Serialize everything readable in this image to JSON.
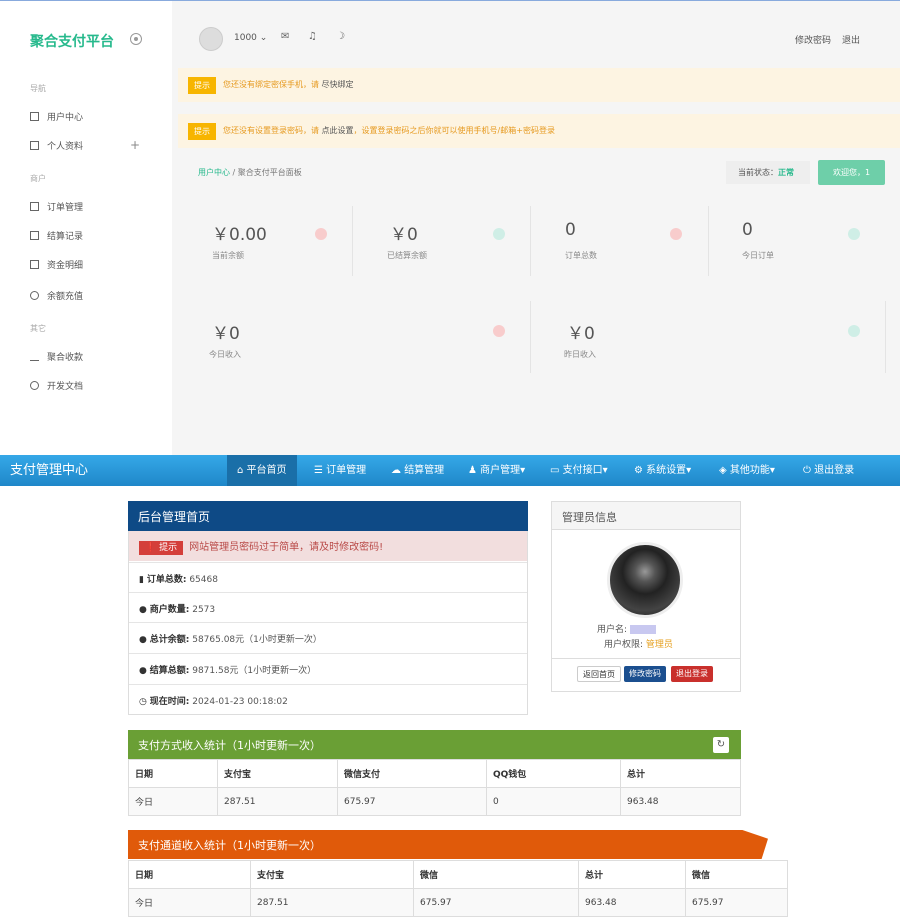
{
  "top_ui": {
    "brand": "聚合支付平台",
    "sidebar": {
      "sections": [
        "导航",
        "商户",
        "其它"
      ],
      "items": [
        {
          "label": "用户中心",
          "icon": "grid-icon"
        },
        {
          "label": "个人资料",
          "icon": "bookmark-icon"
        },
        {
          "label": "订单管理",
          "icon": "monitor-icon"
        },
        {
          "label": "结算记录",
          "icon": "dots-grid-icon"
        },
        {
          "label": "资金明细",
          "icon": "calendar-icon"
        },
        {
          "label": "余额充值",
          "icon": "plus-circle-icon"
        },
        {
          "label": "聚合收款",
          "icon": "bar-chart-icon"
        },
        {
          "label": "开发文档",
          "icon": "cloud-icon"
        }
      ]
    },
    "topbar": {
      "user_id": "1000",
      "change_password": "修改密码",
      "logout": "退出"
    },
    "alerts": [
      {
        "tag": "提示",
        "text": "您还没有绑定密保手机，请",
        "link": "尽快绑定",
        "extra": ""
      },
      {
        "tag": "提示",
        "text": "您还没有设置登录密码，请",
        "link": "点此设置",
        "extra": "，设置登录密码之后你就可以使用手机号/邮箱+密码登录"
      }
    ],
    "breadcrumb": [
      "用户中心",
      "聚合支付平台面板"
    ],
    "status_label": "当前状态：",
    "status_value": "正常",
    "welcome": "欢迎您，1",
    "stats": [
      {
        "value": "￥0.00",
        "label": "当前余额",
        "color": "#f8cccc"
      },
      {
        "value": "￥0",
        "label": "已结算余额",
        "color": "#cfeee6"
      },
      {
        "value": "0",
        "label": "订单总数",
        "color": "#f8cccc"
      },
      {
        "value": "0",
        "label": "今日订单",
        "color": "#cfeee6"
      },
      {
        "value": "￥0",
        "label": "今日收入",
        "color": "#f8cccc"
      },
      {
        "value": "￥0",
        "label": "昨日收入",
        "color": "#cfeee6"
      }
    ]
  },
  "admin_ui": {
    "brand": "支付管理中心",
    "nav": [
      "平台首页",
      "订单管理",
      "结算管理",
      "商户管理▾",
      "支付接口▾",
      "系统设置▾",
      "其他功能▾",
      "退出登录"
    ],
    "home_panel": {
      "title": "后台管理首页",
      "alert_tag": "提示",
      "alert_text": "网站管理员密码过于简单，请及时修改密码!",
      "rows": [
        {
          "label": "订单总数:",
          "value": "65468"
        },
        {
          "label": "商户数量:",
          "value": "2573"
        },
        {
          "label": "总计余额:",
          "value": "58765.08元（1小时更新一次）"
        },
        {
          "label": "结算总额:",
          "value": "9871.58元（1小时更新一次）"
        },
        {
          "label": "现在时间:",
          "value": "2024-01-23 00:18:02"
        }
      ]
    },
    "admin_panel": {
      "title": "管理员信息",
      "username_label": "用户名:",
      "perm_label": "用户权限:",
      "perm_value": "管理员",
      "buttons": [
        "返回首页",
        "修改密码",
        "退出登录"
      ]
    },
    "pay_method_table": {
      "title": "支付方式收入统计（1小时更新一次）",
      "header": [
        "日期",
        "支付宝",
        "微信支付",
        "QQ钱包",
        "总计"
      ],
      "rows": [
        [
          "今日",
          "287.51",
          "675.97",
          "0",
          "963.48"
        ]
      ]
    },
    "channel_table": {
      "title": "支付通道收入统计（1小时更新一次）",
      "header": [
        "日期",
        "支付宝",
        "微信",
        "总计",
        "微信"
      ],
      "rows": [
        [
          "今日",
          "287.51",
          "675.97",
          "963.48",
          "675.97"
        ]
      ]
    }
  }
}
